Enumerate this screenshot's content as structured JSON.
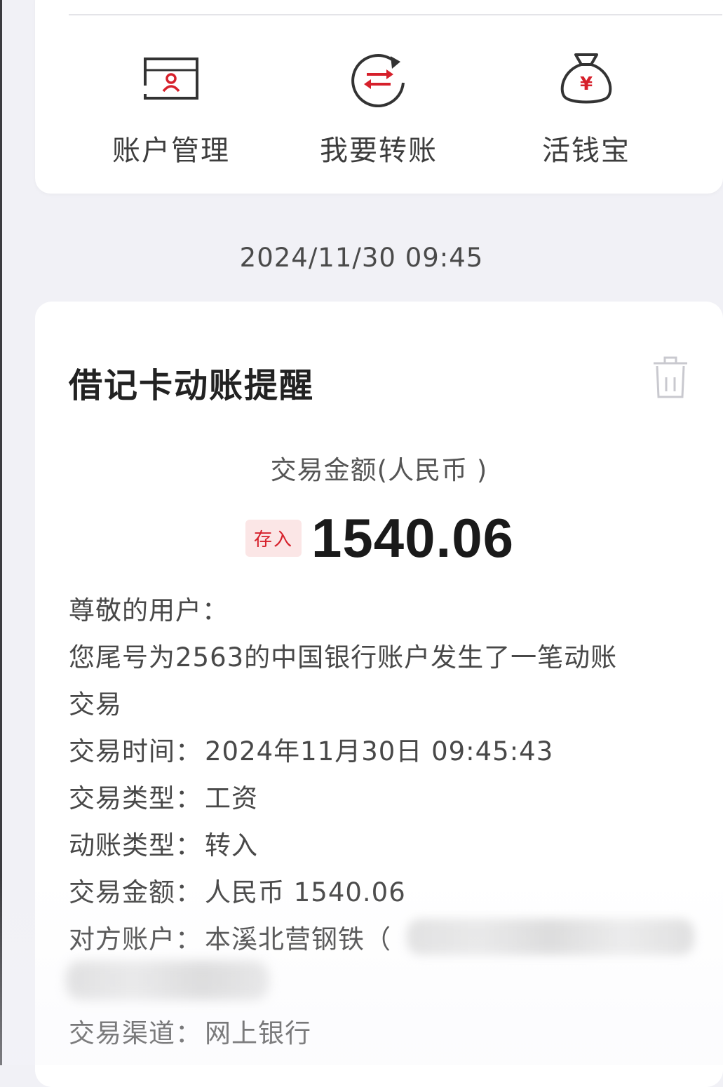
{
  "quick_actions": [
    {
      "label": "账户管理",
      "icon": "account-card-icon"
    },
    {
      "label": "我要转账",
      "icon": "transfer-icon"
    },
    {
      "label": "活钱宝",
      "icon": "money-bag-icon"
    }
  ],
  "timestamp": "2024/11/30 09:45",
  "notice": {
    "title": "借记卡动账提醒",
    "amount_caption": "交易金额(人民币 )",
    "badge": "存入",
    "amount": "1540.06",
    "greeting": "尊敬的用户：",
    "message_line1": "您尾号为2563的中国银行账户发生了一笔动账",
    "message_line2": "交易",
    "details": [
      {
        "key": "交易时间：",
        "value": "2024年11月30日 09:45:43"
      },
      {
        "key": "交易类型：",
        "value": "工资"
      },
      {
        "key": "动账类型：",
        "value": "转入"
      },
      {
        "key": "交易金额：",
        "value": "人民币 1540.06"
      },
      {
        "key": "对方账户：",
        "value": "本溪北营钢铁（"
      },
      {
        "key": "交易渠道：",
        "value": "网上银行"
      }
    ]
  },
  "colors": {
    "accent_red": "#d6202b",
    "background": "#f1f1f6",
    "card": "#ffffff"
  }
}
